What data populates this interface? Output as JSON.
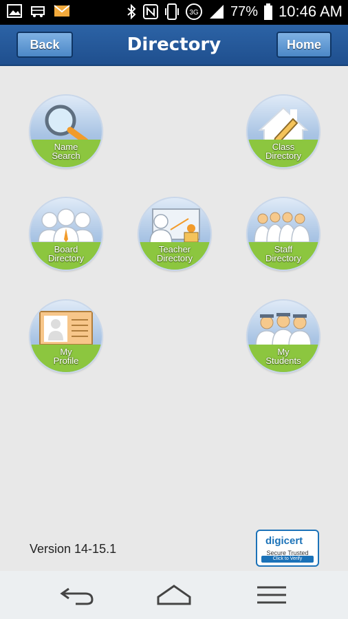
{
  "status_bar": {
    "battery": "77%",
    "time": "10:46 AM",
    "network": "3G",
    "icons": [
      "image-icon",
      "bus-icon",
      "mail-icon",
      "bluetooth-icon",
      "nfc-icon",
      "vibrate-icon",
      "network-icon",
      "signal-icon",
      "battery-icon"
    ]
  },
  "header": {
    "back_label": "Back",
    "title": "Directory",
    "home_label": "Home"
  },
  "tiles": [
    {
      "label": "Name\nSearch",
      "icon": "magnifier-icon"
    },
    {
      "label": "Class\nDirectory",
      "icon": "house-pencil-icon"
    },
    {
      "label": "Board\nDirectory",
      "icon": "board-members-icon"
    },
    {
      "label": "Teacher\nDirectory",
      "icon": "teacher-icon"
    },
    {
      "label": "Staff\nDirectory",
      "icon": "staff-icon"
    },
    {
      "label": "My\nProfile",
      "icon": "profile-card-icon"
    },
    {
      "label": "My\nStudents",
      "icon": "students-icon"
    }
  ],
  "footer": {
    "version": "Version 14-15.1",
    "digicert": {
      "logo": "digicert",
      "tagline": "Secure  Trusted",
      "verify": "Click to Verify"
    }
  },
  "colors": {
    "header": "#2c63a6",
    "band": "#8cc63f",
    "tile_blue": "#a9c4e4"
  }
}
